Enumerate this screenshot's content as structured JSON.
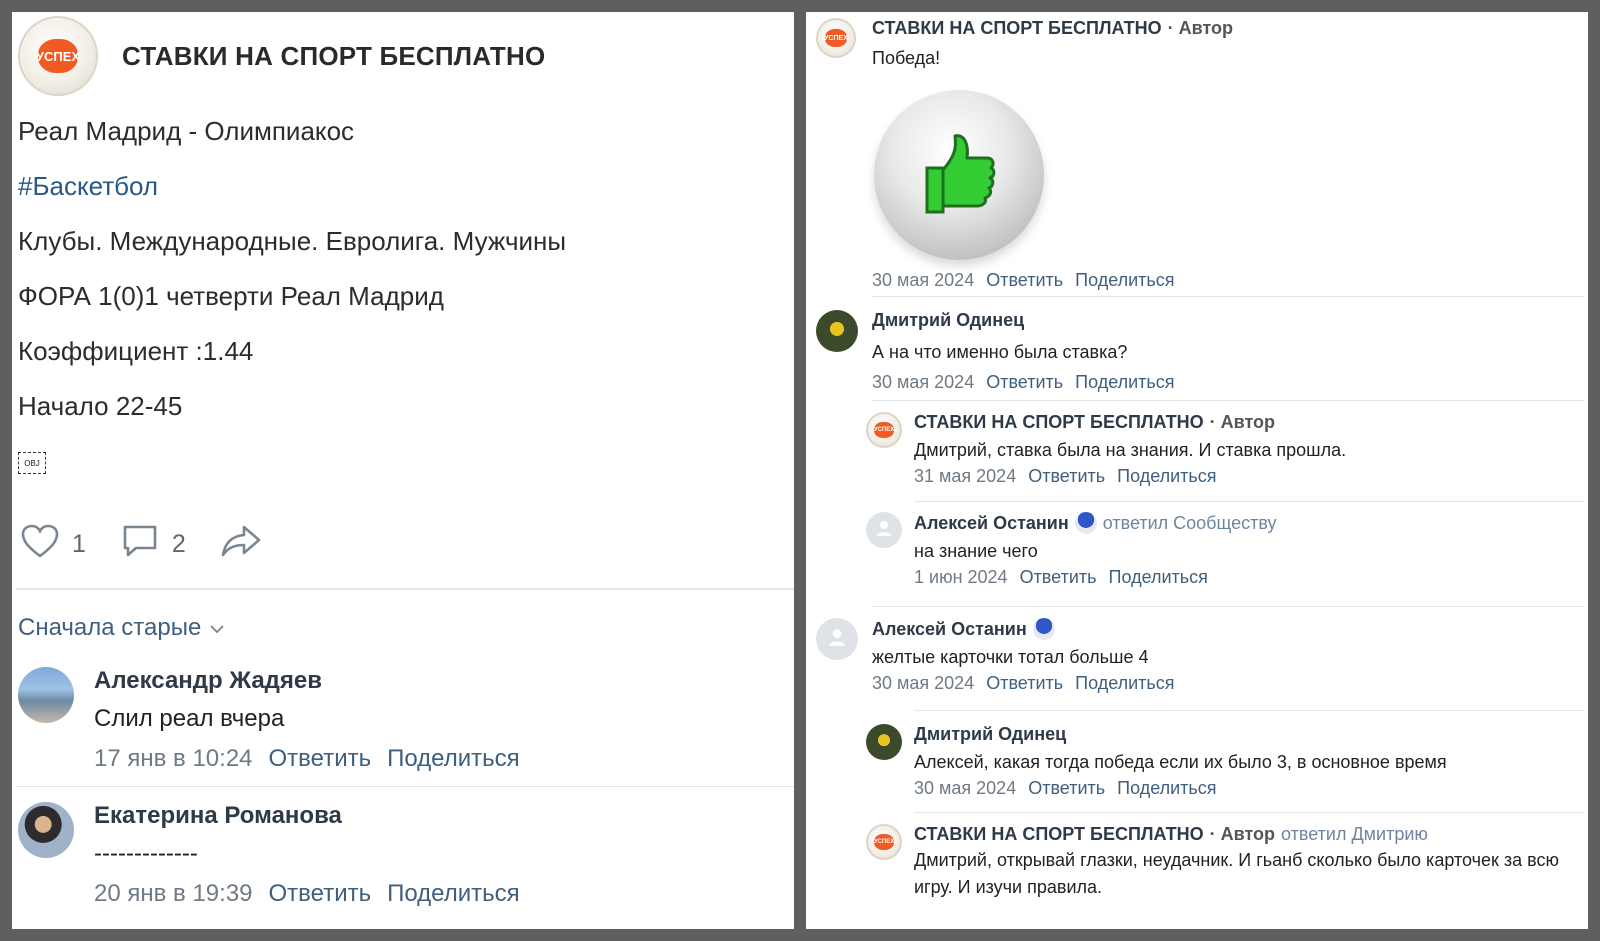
{
  "post": {
    "community_name": "СТАВКИ НА СПОРТ БЕСПЛАТНО",
    "logo_text": "УСПЕХ",
    "lines": {
      "match": "Реал Мадрид - Олимпиакос",
      "hashtag": "#Баскетбол",
      "league": "Клубы. Международные. Евролига. Мужчины",
      "bet": "ФОРА 1(0)1 четверти Реал Мадрид",
      "coef": "Коэффициент :1.44",
      "start": "Начало 22-45"
    },
    "obj_placeholder": "OBJ",
    "likes": "1",
    "comments_count": "2",
    "sort_label": "Сначала старые"
  },
  "left_comments": [
    {
      "name": "Александр Жадяев",
      "text": "Слил реал вчера",
      "date": "17 янв в 10:24",
      "reply": "Ответить",
      "share": "Поделиться"
    },
    {
      "name": "Екатерина Романова",
      "text": "-------------",
      "date": "20 янв в 19:39",
      "reply": "Ответить",
      "share": "Поделиться"
    }
  ],
  "right_comments": [
    {
      "name": "СТАВКИ НА СПОРТ БЕСПЛАТНО",
      "author": "· Автор",
      "text": "Победа!",
      "date": "30 мая 2024",
      "reply": "Ответить",
      "share": "Поделиться"
    },
    {
      "name": "Дмитрий Одинец",
      "text": "А на что именно была ставка?",
      "date": "30 мая 2024",
      "reply": "Ответить",
      "share": "Поделиться"
    },
    {
      "name": "СТАВКИ НА СПОРТ БЕСПЛАТНО",
      "author": "· Автор",
      "text": "Дмитрий, ставка была на знания. И ставка прошла.",
      "date": "31 мая 2024",
      "reply": "Ответить",
      "share": "Поделиться"
    },
    {
      "name": "Алексей Останин",
      "extra": "ответил Сообществу",
      "text": "на знание чего",
      "date": "1 июн 2024",
      "reply": "Ответить",
      "share": "Поделиться"
    },
    {
      "name": "Алексей Останин",
      "text": "желтые карточки тотал больше 4",
      "date": "30 мая 2024",
      "reply": "Ответить",
      "share": "Поделиться"
    },
    {
      "name": "Дмитрий Одинец",
      "text": "Алексей, какая тогда победа если их было 3, в основное время",
      "date": "30 мая 2024",
      "reply": "Ответить",
      "share": "Поделиться"
    },
    {
      "name": "СТАВКИ НА СПОРТ БЕСПЛАТНО",
      "author": "· Автор",
      "extra": "ответил Дмитрию",
      "text": "Дмитрий, открывай глазки, неудачник. И гьанб сколько было карточек за всю игру. И изучи правила."
    }
  ]
}
